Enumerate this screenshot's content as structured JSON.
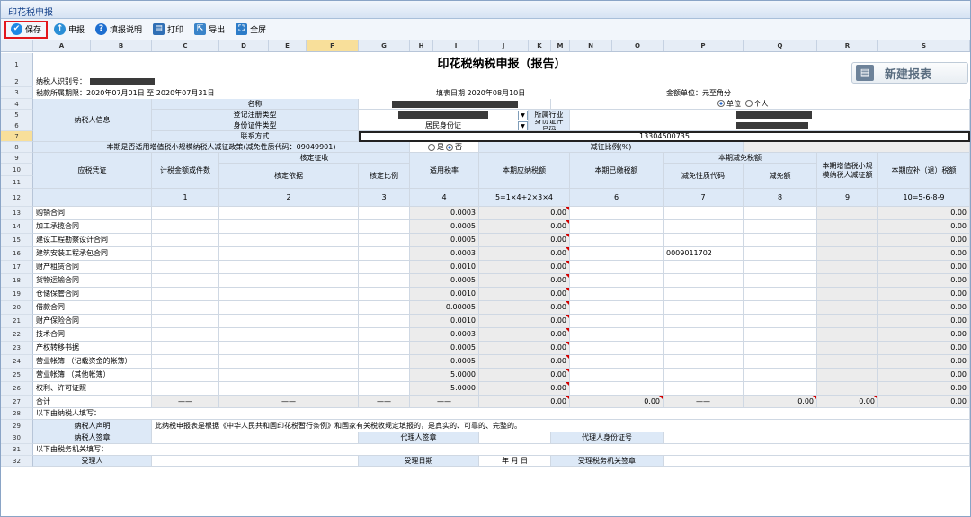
{
  "window_title": "印花税申报",
  "toolbar": [
    {
      "label": "保存",
      "icon": "save-check-icon",
      "color": "#1e88e5"
    },
    {
      "label": "申报",
      "icon": "declare-icon",
      "color": "#2b8fd6"
    },
    {
      "label": "填报说明",
      "icon": "help-icon",
      "color": "#1e6fd0"
    },
    {
      "label": "打印",
      "icon": "printer-icon",
      "color": "#2f6fb5"
    },
    {
      "label": "导出",
      "icon": "export-icon",
      "color": "#3a84c9"
    },
    {
      "label": "全屏",
      "icon": "fullscreen-icon",
      "color": "#2d7cc8"
    }
  ],
  "columns": [
    "A",
    "B",
    "C",
    "D",
    "E",
    "F",
    "G",
    "H",
    "I",
    "J",
    "K",
    "M",
    "N",
    "O",
    "P",
    "Q",
    "R",
    "S"
  ],
  "selected_column": "F",
  "row_numbers": [
    "1",
    "2",
    "3",
    "4",
    "5",
    "6",
    "7",
    "8",
    "9",
    "10",
    "11",
    "12",
    "13",
    "14",
    "15",
    "16",
    "17",
    "18",
    "19",
    "20",
    "21",
    "22",
    "23",
    "24",
    "25",
    "26",
    "27",
    "28",
    "29",
    "30",
    "31",
    "32"
  ],
  "selected_row": "7",
  "new_report_label": "新建报表",
  "form": {
    "title": "印花税纳税申报（报告）",
    "taxpayer_id_label": "纳税人识别号：",
    "period_label": "税款所属期限：2020年07月01日 至 2020年07月31日",
    "fill_date": "填表日期  2020年08月10日",
    "amount_unit": "金额单位：元至角分",
    "info_label": "纳税人信息",
    "name_label": "名称",
    "unit_option": "单位",
    "person_option": "个人",
    "reg_type_label": "登记注册类型",
    "industry_label": "所属行业",
    "id_type_label": "身份证件类型",
    "id_type_value": "居民身份证",
    "id_number_label": "身份证件号码",
    "contact_label": "联系方式",
    "contact_value": "13304500735",
    "small_scale_label": "本期是否适用增值税小规模纳税人减征政策(减免性质代码：09049901)",
    "yes_label": "是",
    "no_label": "否",
    "reduction_ratio_label": "减征比例(%)",
    "hdr_voucher": "应税凭证",
    "hdr_amount": "计税金额或件数",
    "hdr_assess": "核定征收",
    "hdr_basis": "核定依据",
    "hdr_ratio": "核定比例",
    "hdr_rate": "适用税率",
    "hdr_payable": "本期应纳税额",
    "hdr_paid": "本期已缴税额",
    "hdr_relief": "本期减免税额",
    "hdr_relief_code": "减免性质代码",
    "hdr_relief_amount": "减免额",
    "hdr_small_relief": "本期增值税小规模纳税人减征额",
    "hdr_refund": "本期应补（退）税额",
    "idx": [
      "1",
      "2",
      "3",
      "4",
      "5=1×4+2×3×4",
      "6",
      "7",
      "8",
      "9",
      "10=5-6-8-9"
    ],
    "items": [
      {
        "name": "购销合同",
        "rate": "0.0003",
        "payable": "0.00",
        "code": "",
        "refund": "0.00"
      },
      {
        "name": "加工承揽合同",
        "rate": "0.0005",
        "payable": "0.00",
        "code": "",
        "refund": "0.00"
      },
      {
        "name": "建设工程勘察设计合同",
        "rate": "0.0005",
        "payable": "0.00",
        "code": "",
        "refund": "0.00"
      },
      {
        "name": "建筑安装工程承包合同",
        "rate": "0.0003",
        "payable": "0.00",
        "code": "0009011702",
        "refund": "0.00"
      },
      {
        "name": "财产租赁合同",
        "rate": "0.0010",
        "payable": "0.00",
        "code": "",
        "refund": "0.00"
      },
      {
        "name": "货物运输合同",
        "rate": "0.0005",
        "payable": "0.00",
        "code": "",
        "refund": "0.00"
      },
      {
        "name": "仓储保管合同",
        "rate": "0.0010",
        "payable": "0.00",
        "code": "",
        "refund": "0.00"
      },
      {
        "name": "借款合同",
        "rate": "0.00005",
        "payable": "0.00",
        "code": "",
        "refund": "0.00"
      },
      {
        "name": "财产保险合同",
        "rate": "0.0010",
        "payable": "0.00",
        "code": "",
        "refund": "0.00"
      },
      {
        "name": "技术合同",
        "rate": "0.0003",
        "payable": "0.00",
        "code": "",
        "refund": "0.00"
      },
      {
        "name": "产权转移书据",
        "rate": "0.0005",
        "payable": "0.00",
        "code": "",
        "refund": "0.00"
      },
      {
        "name": "营业帐簿 （记载资金的帐簿）",
        "rate": "0.0005",
        "payable": "0.00",
        "code": "",
        "refund": "0.00"
      },
      {
        "name": "营业帐簿 （其他帐簿）",
        "rate": "5.0000",
        "payable": "0.00",
        "code": "",
        "refund": "0.00"
      },
      {
        "name": "权利、许可证照",
        "rate": "5.0000",
        "payable": "0.00",
        "code": "",
        "refund": "0.00"
      }
    ],
    "total": {
      "label": "合计",
      "dash": "——",
      "payable": "0.00",
      "paid": "0.00",
      "relief": "0.00",
      "small": "0.00",
      "refund": "0.00"
    },
    "taxpayer_fill": "以下由纳税人填写：",
    "declaration_label": "纳税人声明",
    "declaration_text": "此纳税申报表是根据《中华人民共和国印花税暂行条例》和国家有关税收规定填报的，是真实的、可靠的、完整的。",
    "sign_label": "纳税人签章",
    "agent_sign_label": "代理人签章",
    "agent_id_label": "代理人身份证号",
    "tax_office_fill": "以下由税务机关填写：",
    "receiver_label": "受理人",
    "receive_date_label": "受理日期",
    "ymd": "年  月  日",
    "office_sign_label": "受理税务机关签章"
  }
}
